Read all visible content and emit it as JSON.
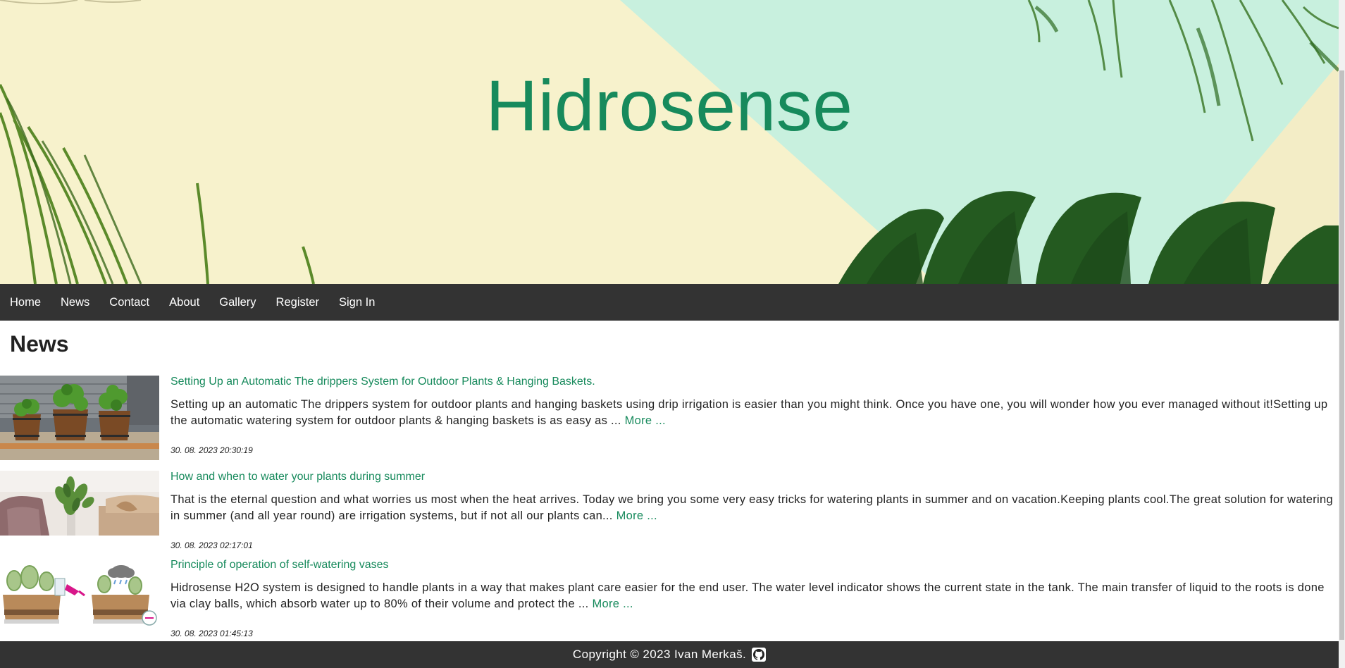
{
  "site": {
    "title": "Hidrosense"
  },
  "nav": {
    "items": [
      {
        "label": "Home"
      },
      {
        "label": "News"
      },
      {
        "label": "Contact"
      },
      {
        "label": "About"
      },
      {
        "label": "Gallery"
      },
      {
        "label": "Register"
      },
      {
        "label": "Sign In"
      }
    ]
  },
  "main": {
    "heading": "News",
    "articles": [
      {
        "title": "Setting Up an Automatic The drippers System for Outdoor Plants & Hanging Baskets.",
        "body": "Setting up an automatic The drippers system for outdoor plants and hanging baskets using drip irrigation is easier than you might think. Once you have one, you will wonder how you ever managed without it!Setting up the automatic watering system for outdoor plants & hanging baskets is as easy as ... ",
        "more": "More ...",
        "date": "30. 08. 2023 20:30:19",
        "image_icon": "wooden-barrel-planters-image"
      },
      {
        "title": "How and when to water your plants during summer",
        "body": "That is the eternal question and what worries us most when the heat arrives. Today we bring you some very easy tricks for watering plants in summer and on vacation.Keeping plants cool.The great solution for watering in summer (and all year round) are irrigation systems, but if not all our plants can... ",
        "more": "More ...",
        "date": "30. 08. 2023 02:17:01",
        "image_icon": "living-room-plants-image"
      },
      {
        "title": "Principle of operation of self-watering vases",
        "body": "Hidrosense H2O system is designed to handle plants in a way that makes plant care easier for the end user. The water level indicator shows the current state in the tank. The main transfer of liquid to the roots is done via clay balls, which absorb water up to 80% of their volume and protect the ... ",
        "more": "More ...",
        "date": "30. 08. 2023 01:45:13",
        "image_icon": "self-watering-vase-diagram-image"
      }
    ]
  },
  "footer": {
    "copyright": "Copyright © 2023 Ivan Merkaš.",
    "icon": "github-icon"
  },
  "colors": {
    "accent": "#178a5c",
    "navbar": "#333333",
    "hero_cream": "#f7f2cc",
    "hero_mint": "#c8f0de"
  }
}
